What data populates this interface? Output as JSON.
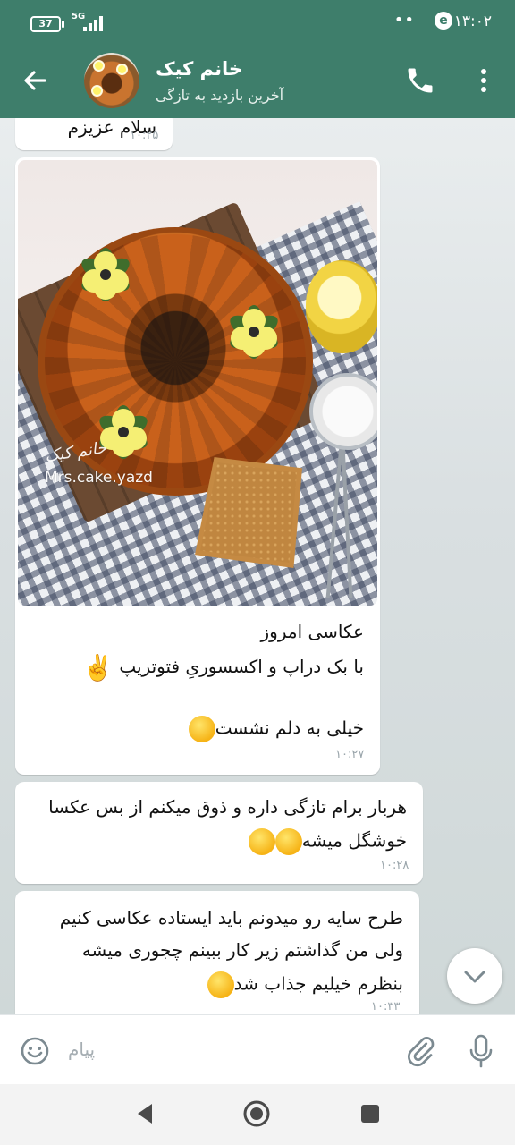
{
  "status_bar": {
    "time": "۱۳:۰۲",
    "battery": "37",
    "network": "5G"
  },
  "header": {
    "title": "خانم کیک",
    "subtitle": "آخرین بازدید به تازگی"
  },
  "messages": [
    {
      "text": "سلام عزیزم",
      "time": "۱۰:۲۵"
    },
    {
      "image_watermark": "Mrs.cake.yazd",
      "image_watermark_fa": "خانم کیک",
      "line1": "عکاسی امروز",
      "line2": "با بک دراپ و اکسسوریِ فتوتریپ",
      "line2_emoji": "✌️",
      "line3": "خیلی به دلم نشست",
      "line3_emoji": "😌",
      "time": "۱۰:۲۷"
    },
    {
      "line1": "هربار برام تازگی داره و ذوق میکنم از بس عکسا",
      "line2": "خوشگل میشه",
      "line2_emojis": "😅😍",
      "time": "۱۰:۲۸"
    },
    {
      "line1": "طرح سایه رو میدونم باید ایستاده عکاسی کنیم",
      "line2": "ولی من گذاشتم زیر کار ببینم چجوری میشه",
      "line3": "بنظرم خیلیم جذاب شد",
      "line3_emoji": "🤩",
      "time": "۱۰:۳۳"
    }
  ],
  "composer": {
    "placeholder": "پیام"
  },
  "icons": {
    "back": "arrow-left-icon",
    "call": "phone-icon",
    "menu": "more-vert-icon",
    "emoji": "smiley-icon",
    "attach": "paperclip-icon",
    "mic": "microphone-icon",
    "scroll": "chevron-down-icon",
    "nav_back": "triangle-back-icon",
    "nav_home": "circle-home-icon",
    "nav_recents": "square-recents-icon"
  },
  "colors": {
    "header": "#3e7e6b",
    "bubble": "#ffffff",
    "time": "#9aa5ab"
  }
}
